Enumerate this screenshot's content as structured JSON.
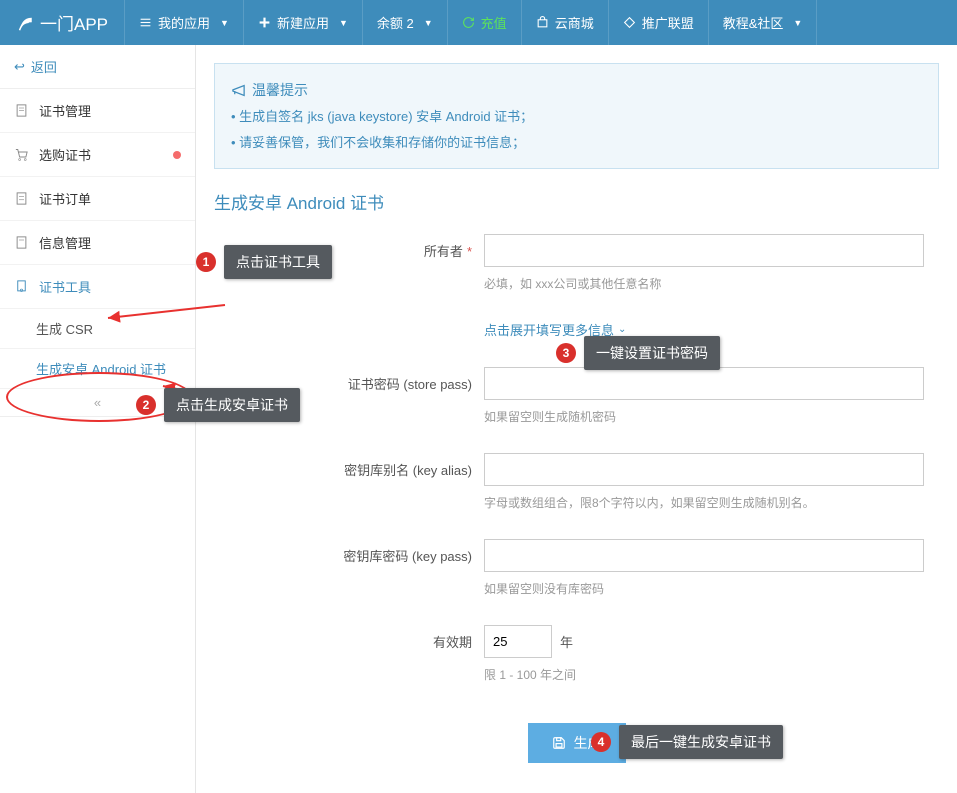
{
  "brand": "一门APP",
  "nav": {
    "my_apps": "我的应用",
    "new_app": "新建应用",
    "balance": "余额 2",
    "recharge": "充值",
    "cloud_mall": "云商城",
    "promo": "推广联盟",
    "tutorial": "教程&社区"
  },
  "sidebar": {
    "back": "返回",
    "cert_manage": "证书管理",
    "buy_cert": "选购证书",
    "cert_orders": "证书订单",
    "info_manage": "信息管理",
    "cert_tools": "证书工具",
    "gen_csr": "生成 CSR",
    "gen_android": "生成安卓 Android 证书"
  },
  "alert": {
    "title": "温馨提示",
    "line1": "• 生成自签名 jks (java keystore) 安卓 Android 证书；",
    "line2": "• 请妥善保管，我们不会收集和存储你的证书信息；"
  },
  "section_title": "生成安卓 Android 证书",
  "form": {
    "owner_label": "所有者",
    "owner_help": "必填，如 xxx公司或其他任意名称",
    "expand": "点击展开填写更多信息",
    "store_pass_label": "证书密码 (store pass)",
    "store_pass_help": "如果留空则生成随机密码",
    "key_alias_label": "密钥库别名 (key alias)",
    "key_alias_help": "字母或数组组合，限8个字符以内，如果留空则生成随机别名。",
    "key_pass_label": "密钥库密码 (key pass)",
    "key_pass_help": "如果留空则没有库密码",
    "valid_label": "有效期",
    "valid_value": "25",
    "valid_unit": "年",
    "valid_help": "限 1 - 100 年之间",
    "submit": "生成"
  },
  "annotations": {
    "a1": "点击证书工具",
    "a2": "点击生成安卓证书",
    "a3": "一键设置证书密码",
    "a4": "最后一键生成安卓证书"
  }
}
